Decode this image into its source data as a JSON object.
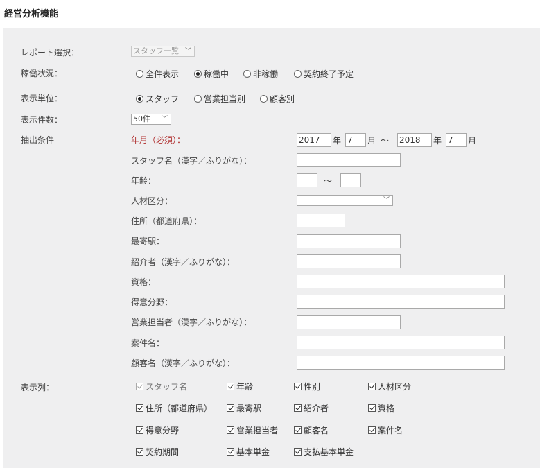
{
  "page_title": "経営分析機能",
  "report": {
    "label": "レポート選択：",
    "value": "スタッフ一覧"
  },
  "status": {
    "label": "稼働状況：",
    "options": [
      "全件表示",
      "稼働中",
      "非稼働",
      "契約終了予定"
    ],
    "selected": "稼働中"
  },
  "unit": {
    "label": "表示単位：",
    "options": [
      "スタッフ",
      "営業担当別",
      "顧客別"
    ],
    "selected": "スタッフ"
  },
  "count": {
    "label": "表示件数：",
    "value": "50件"
  },
  "filters": {
    "label": "抽出条件",
    "year_month": {
      "label": "年月（必須）：",
      "from_year": "2017",
      "year_unit": "年",
      "from_month": "7",
      "month_unit": "月",
      "tilde": "～",
      "to_year": "2018",
      "to_month": "7"
    },
    "staff_name": "スタッフ名（漢字／ふりがな）：",
    "age": {
      "label": "年齢：",
      "tilde": "～"
    },
    "category": "人材区分：",
    "address": "住所（都道府県）：",
    "station": "最寄駅：",
    "referrer": "紹介者（漢字／ふりがな）：",
    "qualification": "資格：",
    "specialty": "得意分野：",
    "sales_rep": "営業担当者（漢字／ふりがな）：",
    "project": "案件名：",
    "customer": "顧客名（漢字／ふりがな）："
  },
  "columns": {
    "label": "表示列：",
    "items": [
      "スタッフ名",
      "年齢",
      "性別",
      "人材区分",
      "住所（都道府県）",
      "最寄駅",
      "紹介者",
      "資格",
      "得意分野",
      "営業担当者",
      "顧客名",
      "案件名",
      "契約期間",
      "基本単金",
      "支払基本単金"
    ]
  }
}
